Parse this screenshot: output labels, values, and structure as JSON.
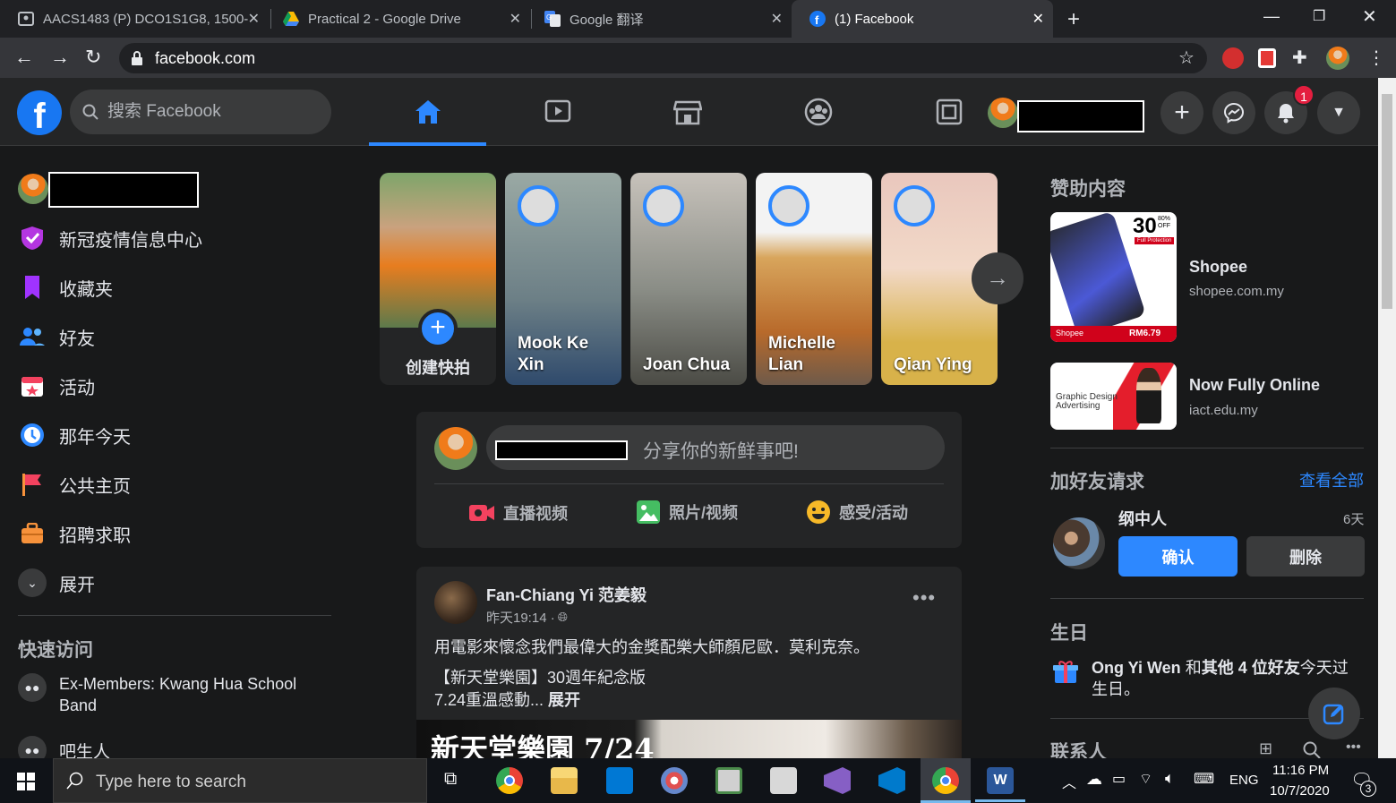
{
  "browser": {
    "tabs": [
      {
        "title": "AACS1483 (P) DCO1S1G8, 1500-",
        "icon": "classroom-icon"
      },
      {
        "title": "Practical 2 - Google Drive",
        "icon": "google-drive-icon"
      },
      {
        "title": "Google 翻译",
        "icon": "google-translate-icon"
      },
      {
        "title": "(1) Facebook",
        "icon": "facebook-icon",
        "active": true
      }
    ],
    "url": "facebook.com"
  },
  "header": {
    "search_placeholder": "搜索 Facebook",
    "notification_count": "1"
  },
  "sidebar": {
    "items": [
      {
        "label": "新冠疫情信息中心",
        "icon": "covid-shield-icon"
      },
      {
        "label": "收藏夹",
        "icon": "bookmark-icon"
      },
      {
        "label": "好友",
        "icon": "friends-icon"
      },
      {
        "label": "活动",
        "icon": "calendar-icon"
      },
      {
        "label": "那年今天",
        "icon": "memories-clock-icon"
      },
      {
        "label": "公共主页",
        "icon": "flag-icon"
      },
      {
        "label": "招聘求职",
        "icon": "briefcase-icon"
      },
      {
        "label": "展开",
        "icon": "chevron-down-icon"
      }
    ],
    "shortcuts_title": "快速访问",
    "shortcuts": [
      {
        "label": "Ex-Members: Kwang Hua School Band"
      },
      {
        "label": "吧生人"
      }
    ]
  },
  "stories": [
    {
      "name": "创建快拍"
    },
    {
      "name": "Mook Ke Xin"
    },
    {
      "name": "Joan Chua"
    },
    {
      "name": "Michelle Lian"
    },
    {
      "name": "Qian Ying"
    }
  ],
  "composer": {
    "prompt": "分享你的新鲜事吧!",
    "actions": [
      {
        "label": "直播视频",
        "color": "#f3425f"
      },
      {
        "label": "照片/视频",
        "color": "#45bd62"
      },
      {
        "label": "感受/活动",
        "color": "#f7b928"
      }
    ]
  },
  "post": {
    "author": "Fan-Chiang Yi 范姜毅",
    "time": "昨天19:14 · ",
    "line1": "用電影來懷念我們最偉大的金獎配樂大師顏尼歐．莫利克奈。",
    "line2": "【新天堂樂園】30週年紀念版",
    "line3": "7.24重溫感動... ",
    "see_more": "展开",
    "image_caption": "新天堂樂園 7/24"
  },
  "right": {
    "sponsored_title": "赞助内容",
    "ads": [
      {
        "title": "Shopee",
        "domain": "shopee.com.my"
      },
      {
        "title": "Now Fully Online",
        "domain": "iact.edu.my"
      }
    ],
    "ad1_badge": "30",
    "ad1_off": "80% OFF",
    "ad1_price": "RM6.79",
    "ad1_brand": "Shopee",
    "ad1_sub": "Full Protection",
    "ad2_text": "Graphic Design Advertising",
    "friend_requests_title": "加好友请求",
    "see_all": "查看全部",
    "request": {
      "name": "纲中人",
      "age": "6天",
      "confirm": "确认",
      "delete": "删除"
    },
    "birthday_title": "生日",
    "birthday_name": "Ong Yi Wen",
    "birthday_and": " 和",
    "birthday_others": "其他 4 位好友",
    "birthday_rest": "今天过",
    "birthday_rest2": "生日。",
    "contacts_title": "联系人"
  },
  "taskbar": {
    "search_placeholder": "Type here to search",
    "lang": "ENG",
    "time": "11:16 PM",
    "date": "10/7/2020",
    "notif_count": "3"
  }
}
